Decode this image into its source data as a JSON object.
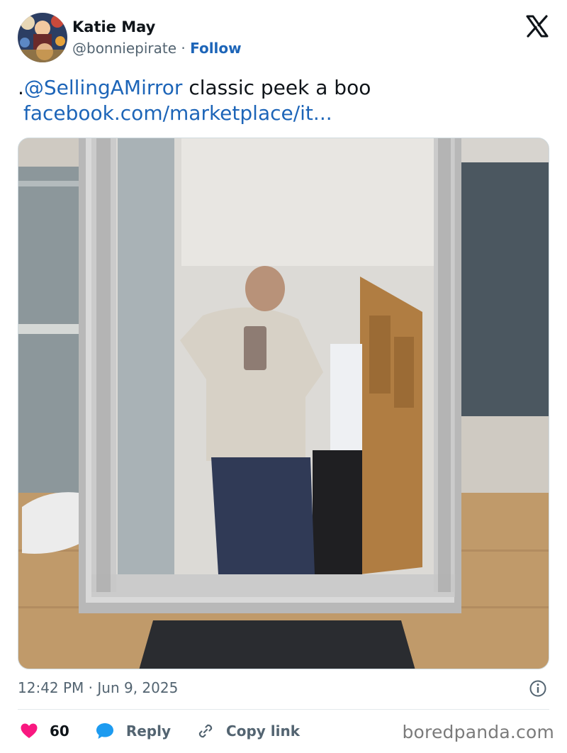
{
  "author": {
    "name": "Katie May",
    "handle": "@bonniepirate",
    "separator": "·",
    "follow_label": "Follow",
    "avatar_icon": "avatar-photo"
  },
  "platform_icon": "x-logo-icon",
  "tweet": {
    "prefix": ".",
    "mention": "@SellingAMirror",
    "body": " classic peek a boo",
    "link": "facebook.com/marketplace/it..."
  },
  "media": {
    "description_icon": "mirror-selfie-photo"
  },
  "meta": {
    "timestamp": "12:42 PM · Jun 9, 2025"
  },
  "actions": {
    "likes_count": "60",
    "reply_label": "Reply",
    "copy_link_label": "Copy link"
  },
  "watermark": "boredpanda.com",
  "colors": {
    "link": "#1d65b8",
    "muted": "#536471",
    "like": "#f91880",
    "reply": "#1d9bf0"
  }
}
